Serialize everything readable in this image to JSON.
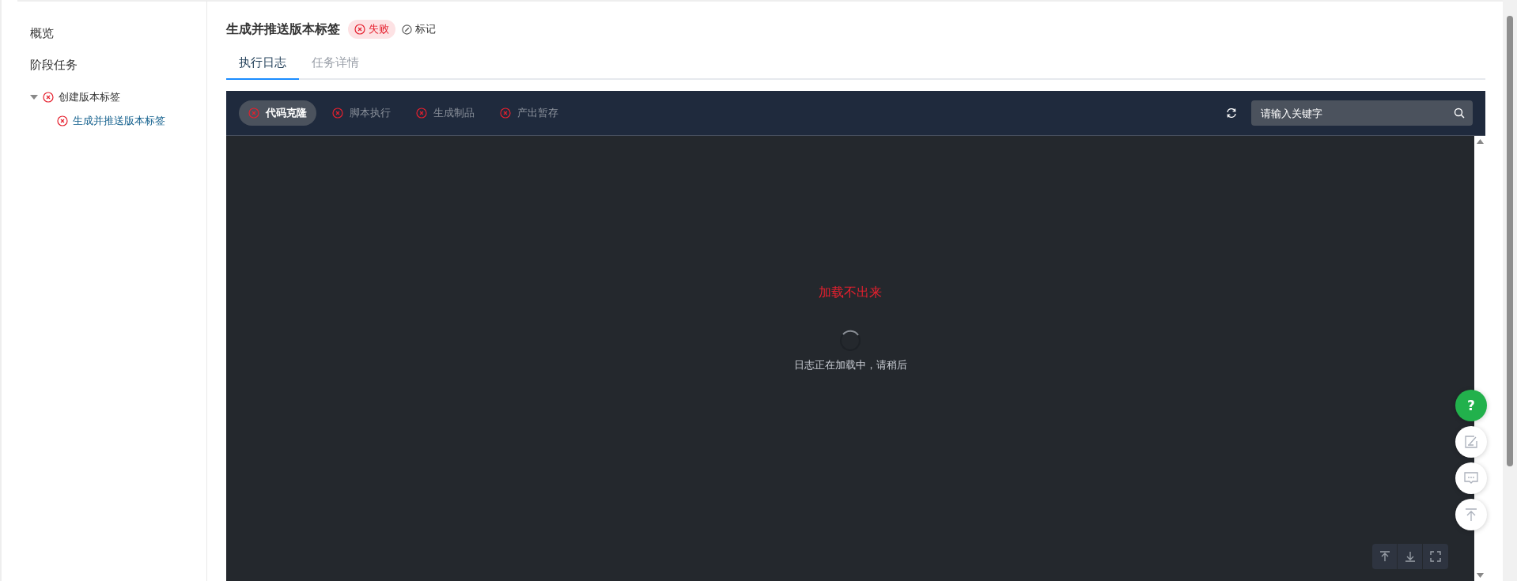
{
  "sidebar": {
    "items": [
      {
        "label": "概览",
        "selected": false
      },
      {
        "label": "阶段任务",
        "selected": false
      }
    ],
    "tree": [
      {
        "label": "创建版本标签",
        "failed": true,
        "expanded": true,
        "selected": false,
        "children": [
          {
            "label": "生成并推送版本标签",
            "failed": true,
            "selected": true
          }
        ]
      }
    ]
  },
  "header": {
    "title": "生成并推送版本标签",
    "status_badge": {
      "label": "失败",
      "failed": true
    },
    "mark_link": "标记"
  },
  "tabs": [
    {
      "label": "执行日志",
      "selected": true
    },
    {
      "label": "任务详情",
      "selected": false
    }
  ],
  "log_panel": {
    "steps": [
      {
        "label": "代码克隆",
        "failed": true,
        "selected": true
      },
      {
        "label": "脚本执行",
        "failed": true,
        "selected": false
      },
      {
        "label": "生成制品",
        "failed": true,
        "selected": false
      },
      {
        "label": "产出暂存",
        "failed": true,
        "selected": false
      }
    ],
    "search": {
      "placeholder": "请输入关键字"
    },
    "error_text": "加载不出来",
    "loading_text": "日志正在加载中，请稍后"
  },
  "help_button": "?"
}
